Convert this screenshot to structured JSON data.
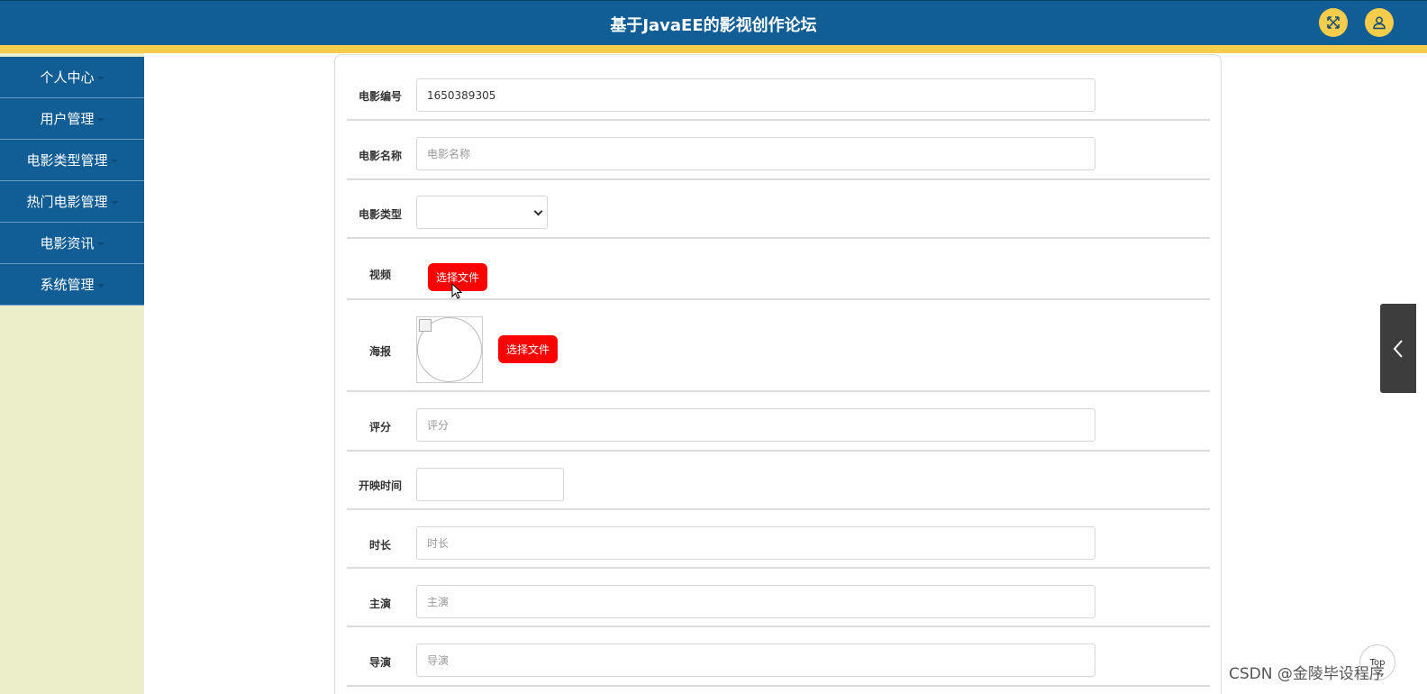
{
  "header": {
    "title": "基于JavaEE的影视创作论坛",
    "fullscreen_icon": "expand-icon",
    "user_icon": "user-icon"
  },
  "sidebar": {
    "items": [
      {
        "label": "个人中心"
      },
      {
        "label": "用户管理"
      },
      {
        "label": "电影类型管理"
      },
      {
        "label": "热门电影管理"
      },
      {
        "label": "电影资讯"
      },
      {
        "label": "系统管理"
      }
    ]
  },
  "form": {
    "movie_id": {
      "label": "电影编号",
      "value": "1650389305"
    },
    "movie_name": {
      "label": "电影名称",
      "placeholder": "电影名称"
    },
    "movie_type": {
      "label": "电影类型",
      "value": ""
    },
    "video": {
      "label": "视频",
      "button": "选择文件"
    },
    "poster": {
      "label": "海报",
      "button": "选择文件"
    },
    "rating": {
      "label": "评分",
      "placeholder": "评分"
    },
    "release_time": {
      "label": "开映时间",
      "value": ""
    },
    "duration": {
      "label": "时长",
      "placeholder": "时长"
    },
    "lead_actor": {
      "label": "主演",
      "placeholder": "主演"
    },
    "director": {
      "label": "导演",
      "placeholder": "导演"
    }
  },
  "side_tab": {
    "icon": "chevron-left-icon"
  },
  "top_button": {
    "label": "Top"
  },
  "watermark": "CSDN @金陵毕设程序",
  "colors": {
    "header": "#115d96",
    "accent": "#f6cd4a",
    "sidebar_bg": "#ecedc9",
    "file_button": "#ff0000"
  }
}
